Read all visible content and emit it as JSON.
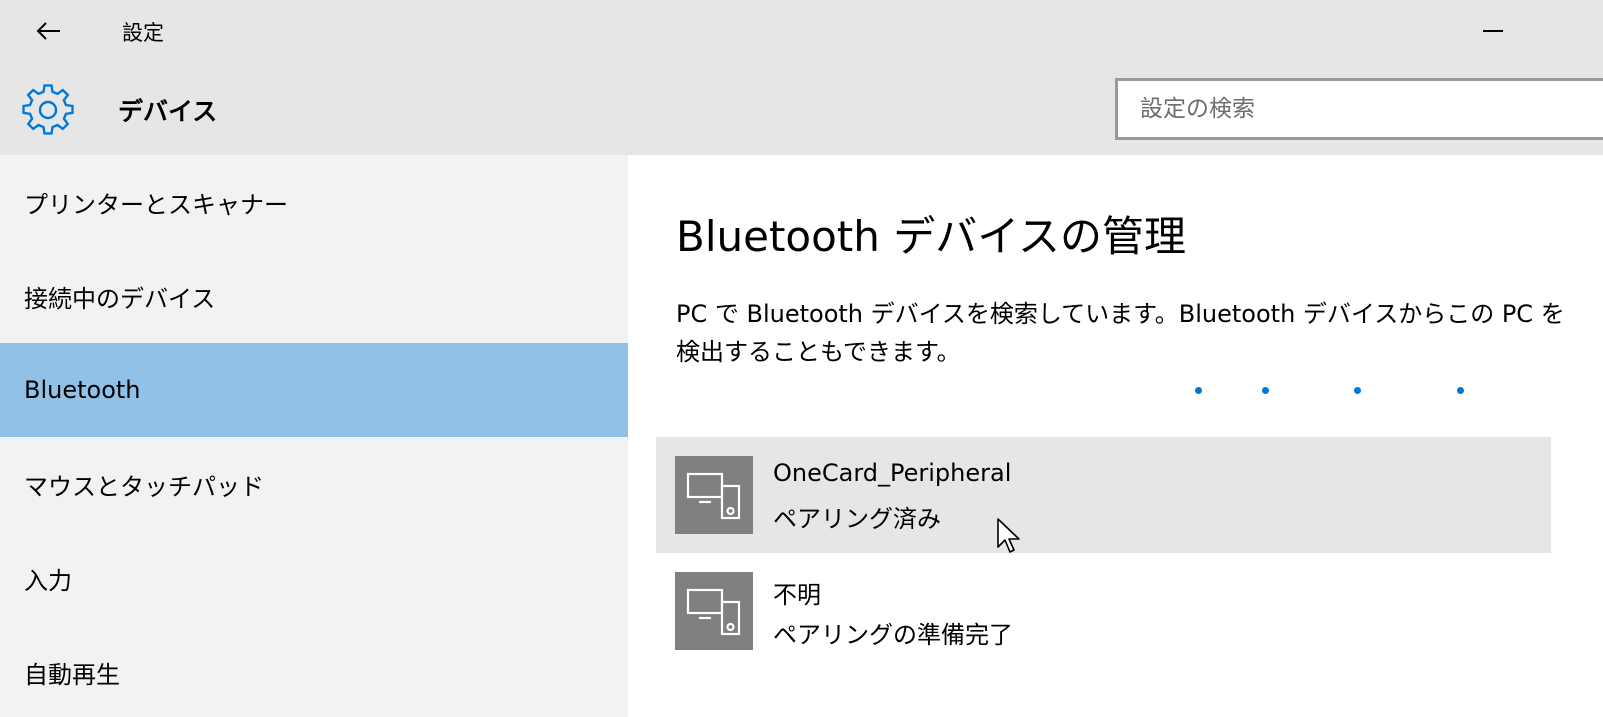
{
  "window": {
    "title": "設定"
  },
  "header": {
    "title": "デバイス",
    "icon": "gear-icon",
    "accent_color": "#0078d7"
  },
  "search": {
    "placeholder": "設定の検索"
  },
  "sidebar": {
    "items": [
      {
        "label": "プリンターとスキャナー",
        "selected": false
      },
      {
        "label": "接続中のデバイス",
        "selected": false
      },
      {
        "label": "Bluetooth",
        "selected": true
      },
      {
        "label": "マウスとタッチパッド",
        "selected": false
      },
      {
        "label": "入力",
        "selected": false
      },
      {
        "label": "自動再生",
        "selected": false
      }
    ],
    "selected_color": "#91c1e7"
  },
  "main": {
    "title": "Bluetooth デバイスの管理",
    "description": "PC で Bluetooth デバイスを検索しています。Bluetooth デバイスからこの PC を検出することもできます。",
    "devices": [
      {
        "name": "OneCard_Peripheral",
        "status": "ペアリング済み",
        "icon": "device-icon"
      },
      {
        "name": "不明",
        "status": "ペアリングの準備完了",
        "icon": "device-icon"
      }
    ]
  }
}
